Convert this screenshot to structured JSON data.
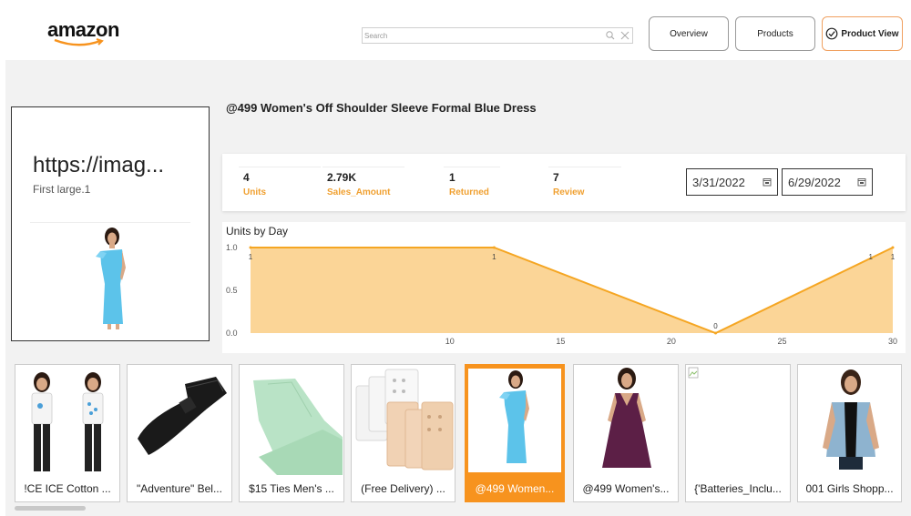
{
  "header": {
    "logo_text": "amazon",
    "search": {
      "placeholder": "Search",
      "value": ""
    },
    "nav": [
      {
        "label": "Overview",
        "active": false
      },
      {
        "label": "Products",
        "active": false
      },
      {
        "label": "Product View",
        "active": true
      }
    ]
  },
  "image_card": {
    "url_text": "https://imag...",
    "subtitle": "First large.1"
  },
  "product": {
    "title": "@499 Women's Off Shoulder Sleeve Formal Blue Dress"
  },
  "kpis": [
    {
      "value": "4",
      "label": "Units"
    },
    {
      "value": "2.79K",
      "label": "Sales_Amount"
    },
    {
      "value": "1",
      "label": "Returned"
    },
    {
      "value": "7",
      "label": "Review"
    }
  ],
  "date_range": {
    "start": "3/31/2022",
    "end": "6/29/2022"
  },
  "chart_data": {
    "type": "area",
    "title": "Units by Day",
    "xlabel": "",
    "ylabel": "",
    "x": [
      1,
      12,
      22,
      30
    ],
    "series": [
      {
        "values": [
          1,
          1,
          0,
          1
        ]
      }
    ],
    "point_labels": [
      {
        "x": 1,
        "y": 1
      },
      {
        "x": 12,
        "y": 1
      },
      {
        "x": 22,
        "y": 0
      },
      {
        "x": 29,
        "y": 1
      },
      {
        "x": 30,
        "y": 1
      }
    ],
    "xlim": [
      1,
      30
    ],
    "ylim": [
      0,
      1
    ],
    "x_ticks": [
      "10",
      "15",
      "20",
      "25",
      "30"
    ],
    "y_ticks": [
      "1.0",
      "0.5",
      "0.0"
    ],
    "color": "#f5a623",
    "fill_color": "#fbd597",
    "grid": false,
    "legend": "none"
  },
  "thumbnails": [
    {
      "label": "!CE ICE Cotton ...",
      "icon": "kids-clothing-image",
      "active": false
    },
    {
      "label": "\"Adventure\" Bel...",
      "icon": "black-belt-image",
      "active": false
    },
    {
      "label": "$15 Ties Men's ...",
      "icon": "green-tie-image",
      "active": false
    },
    {
      "label": "(Free Delivery) ...",
      "icon": "bra-extender-image",
      "active": false
    },
    {
      "label": "@499 Women...",
      "icon": "blue-dress-image",
      "active": true
    },
    {
      "label": "@499 Women's...",
      "icon": "purple-dress-image",
      "active": false
    },
    {
      "label": "{'Batteries_Inclu...",
      "icon": "broken-image-icon",
      "active": false
    },
    {
      "label": "001 Girls Shopp...",
      "icon": "denim-jacket-image",
      "active": false
    }
  ],
  "colors": {
    "accent": "#f7931e",
    "kpi_label": "#f0a030"
  }
}
